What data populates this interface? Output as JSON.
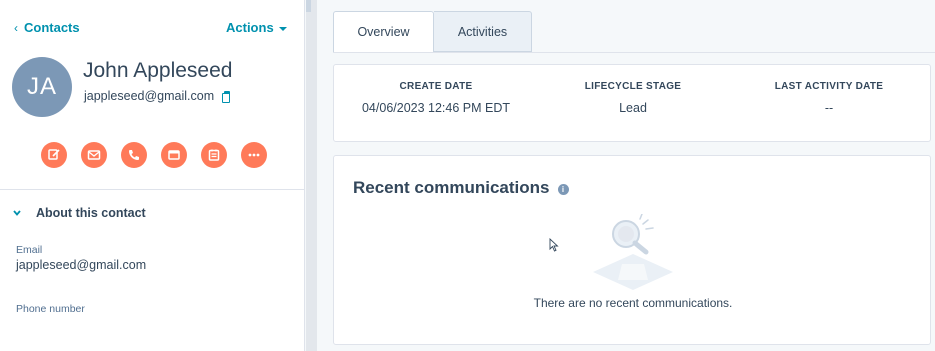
{
  "sidebar": {
    "back_label": "Contacts",
    "actions_label": "Actions",
    "avatar_initials": "JA",
    "contact_name": "John Appleseed",
    "contact_email": "jappleseed@gmail.com",
    "action_buttons": [
      "note-icon",
      "email-icon",
      "call-icon",
      "log-activity-icon",
      "task-icon",
      "more-icon"
    ],
    "about_header": "About this contact",
    "fields": [
      {
        "label": "Email",
        "value": "jappleseed@gmail.com"
      },
      {
        "label": "Phone number",
        "value": ""
      }
    ]
  },
  "tabs": [
    {
      "label": "Overview",
      "active": true
    },
    {
      "label": "Activities",
      "active": false
    }
  ],
  "stats": [
    {
      "label": "CREATE DATE",
      "value": "04/06/2023 12:46 PM EDT"
    },
    {
      "label": "LIFECYCLE STAGE",
      "value": "Lead"
    },
    {
      "label": "LAST ACTIVITY DATE",
      "value": "--"
    }
  ],
  "communications": {
    "title": "Recent communications",
    "empty_text": "There are no recent communications."
  },
  "colors": {
    "accent": "#0091ae",
    "action_button": "#ff7a59",
    "avatar": "#7c98b6",
    "text": "#33475b"
  }
}
